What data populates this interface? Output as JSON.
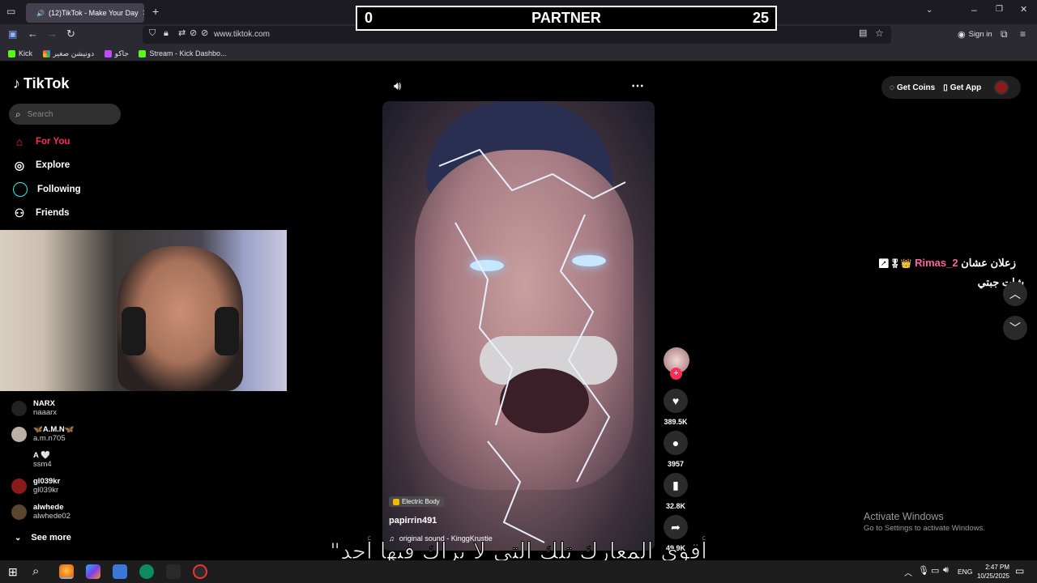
{
  "browser": {
    "tab_title": "(12)TikTok - Make Your Day",
    "url": "www.tiktok.com",
    "sign_in": "Sign in",
    "bookmarks": [
      {
        "label": "Kick",
        "color": "#53fc18"
      },
      {
        "label": "دونيشن صغير",
        "color": "#e8e8e8"
      },
      {
        "label": "جاكو",
        "color": "#c24bff"
      },
      {
        "label": "Stream - Kick Dashbo...",
        "color": "#53fc18"
      }
    ]
  },
  "score_overlay": {
    "left": "0",
    "title": "PARTNER",
    "right": "25"
  },
  "tiktok": {
    "logo": "TikTok",
    "search_placeholder": "Search",
    "nav": [
      {
        "label": "For You",
        "icon": "home-icon",
        "active": true
      },
      {
        "label": "Explore",
        "icon": "compass-icon"
      },
      {
        "label": "Following",
        "icon": "following-icon"
      },
      {
        "label": "Friends",
        "icon": "friends-icon"
      }
    ],
    "following_accounts": [
      {
        "name": "NARX",
        "handle": "naaarx"
      },
      {
        "name": "🦋A.M.N🦋",
        "handle": "a.m.n705"
      },
      {
        "name": "A 🤍",
        "handle": "ssm4"
      },
      {
        "name": "gl039kr",
        "handle": "gl039kr"
      },
      {
        "name": "alwhede",
        "handle": "alwhede02"
      }
    ],
    "see_more": "See more",
    "top_actions": {
      "get_coins": "Get Coins",
      "get_app": "Get App"
    },
    "video": {
      "effect": "Electric Body",
      "author": "papirrin491",
      "sound": "original sound - KinggKrustie"
    },
    "actions": {
      "likes": "389.5K",
      "comments": "3957",
      "saves": "32.8K",
      "shares": "49.9K"
    }
  },
  "chat_overlay": {
    "line1_name": "Rimas_2",
    "line1_text": "زعلان عشان",
    "line2_text": "شات جبتي"
  },
  "subtitle": "أقوى المعارك تلك التي لا يراك فيها أحد\"",
  "windows": {
    "activate_title": "Activate Windows",
    "activate_sub": "Go to Settings to activate Windows.",
    "language": "ENG",
    "time": "2:47 PM",
    "date": "10/25/2025"
  }
}
